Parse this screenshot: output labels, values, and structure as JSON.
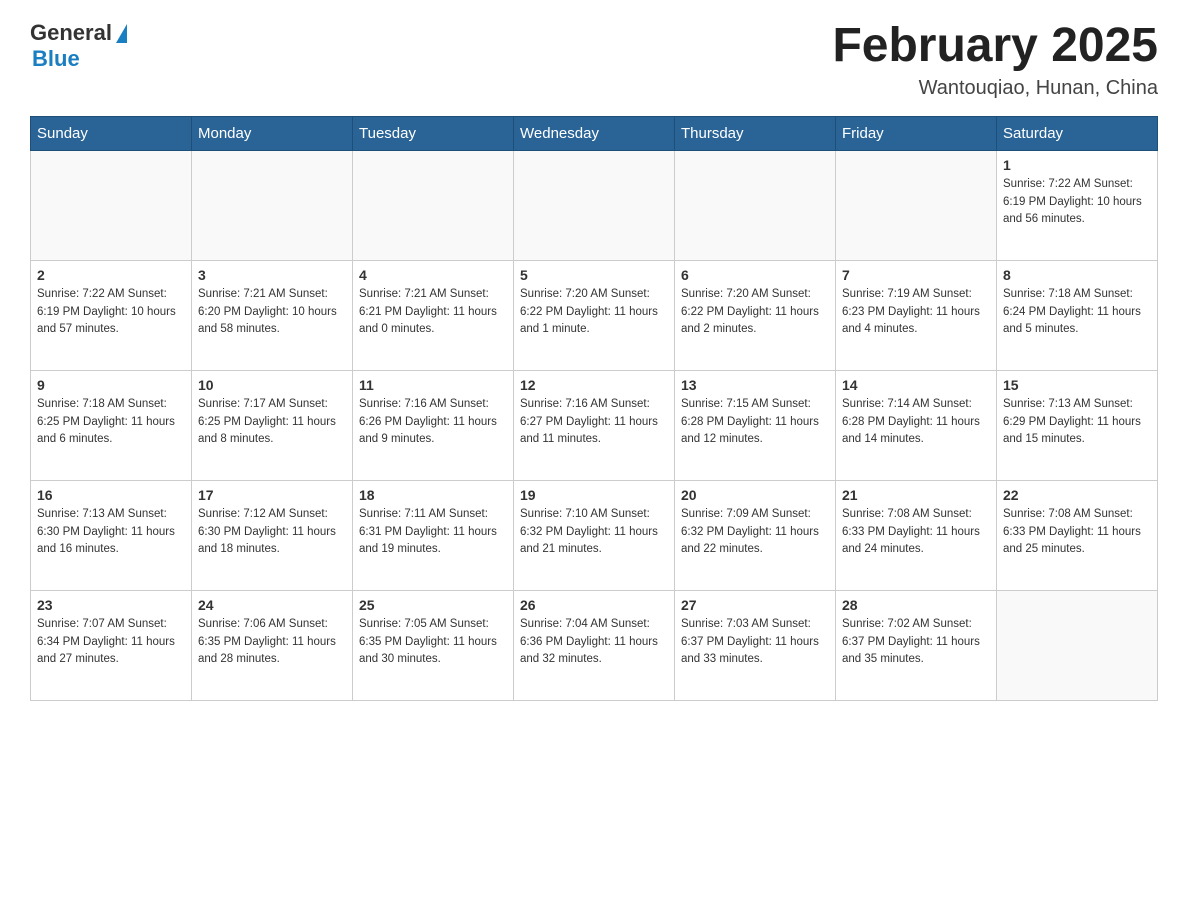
{
  "logo": {
    "general": "General",
    "blue": "Blue"
  },
  "title": "February 2025",
  "subtitle": "Wantouqiao, Hunan, China",
  "days_of_week": [
    "Sunday",
    "Monday",
    "Tuesday",
    "Wednesday",
    "Thursday",
    "Friday",
    "Saturday"
  ],
  "weeks": [
    [
      {
        "day": "",
        "info": ""
      },
      {
        "day": "",
        "info": ""
      },
      {
        "day": "",
        "info": ""
      },
      {
        "day": "",
        "info": ""
      },
      {
        "day": "",
        "info": ""
      },
      {
        "day": "",
        "info": ""
      },
      {
        "day": "1",
        "info": "Sunrise: 7:22 AM\nSunset: 6:19 PM\nDaylight: 10 hours\nand 56 minutes."
      }
    ],
    [
      {
        "day": "2",
        "info": "Sunrise: 7:22 AM\nSunset: 6:19 PM\nDaylight: 10 hours\nand 57 minutes."
      },
      {
        "day": "3",
        "info": "Sunrise: 7:21 AM\nSunset: 6:20 PM\nDaylight: 10 hours\nand 58 minutes."
      },
      {
        "day": "4",
        "info": "Sunrise: 7:21 AM\nSunset: 6:21 PM\nDaylight: 11 hours\nand 0 minutes."
      },
      {
        "day": "5",
        "info": "Sunrise: 7:20 AM\nSunset: 6:22 PM\nDaylight: 11 hours\nand 1 minute."
      },
      {
        "day": "6",
        "info": "Sunrise: 7:20 AM\nSunset: 6:22 PM\nDaylight: 11 hours\nand 2 minutes."
      },
      {
        "day": "7",
        "info": "Sunrise: 7:19 AM\nSunset: 6:23 PM\nDaylight: 11 hours\nand 4 minutes."
      },
      {
        "day": "8",
        "info": "Sunrise: 7:18 AM\nSunset: 6:24 PM\nDaylight: 11 hours\nand 5 minutes."
      }
    ],
    [
      {
        "day": "9",
        "info": "Sunrise: 7:18 AM\nSunset: 6:25 PM\nDaylight: 11 hours\nand 6 minutes."
      },
      {
        "day": "10",
        "info": "Sunrise: 7:17 AM\nSunset: 6:25 PM\nDaylight: 11 hours\nand 8 minutes."
      },
      {
        "day": "11",
        "info": "Sunrise: 7:16 AM\nSunset: 6:26 PM\nDaylight: 11 hours\nand 9 minutes."
      },
      {
        "day": "12",
        "info": "Sunrise: 7:16 AM\nSunset: 6:27 PM\nDaylight: 11 hours\nand 11 minutes."
      },
      {
        "day": "13",
        "info": "Sunrise: 7:15 AM\nSunset: 6:28 PM\nDaylight: 11 hours\nand 12 minutes."
      },
      {
        "day": "14",
        "info": "Sunrise: 7:14 AM\nSunset: 6:28 PM\nDaylight: 11 hours\nand 14 minutes."
      },
      {
        "day": "15",
        "info": "Sunrise: 7:13 AM\nSunset: 6:29 PM\nDaylight: 11 hours\nand 15 minutes."
      }
    ],
    [
      {
        "day": "16",
        "info": "Sunrise: 7:13 AM\nSunset: 6:30 PM\nDaylight: 11 hours\nand 16 minutes."
      },
      {
        "day": "17",
        "info": "Sunrise: 7:12 AM\nSunset: 6:30 PM\nDaylight: 11 hours\nand 18 minutes."
      },
      {
        "day": "18",
        "info": "Sunrise: 7:11 AM\nSunset: 6:31 PM\nDaylight: 11 hours\nand 19 minutes."
      },
      {
        "day": "19",
        "info": "Sunrise: 7:10 AM\nSunset: 6:32 PM\nDaylight: 11 hours\nand 21 minutes."
      },
      {
        "day": "20",
        "info": "Sunrise: 7:09 AM\nSunset: 6:32 PM\nDaylight: 11 hours\nand 22 minutes."
      },
      {
        "day": "21",
        "info": "Sunrise: 7:08 AM\nSunset: 6:33 PM\nDaylight: 11 hours\nand 24 minutes."
      },
      {
        "day": "22",
        "info": "Sunrise: 7:08 AM\nSunset: 6:33 PM\nDaylight: 11 hours\nand 25 minutes."
      }
    ],
    [
      {
        "day": "23",
        "info": "Sunrise: 7:07 AM\nSunset: 6:34 PM\nDaylight: 11 hours\nand 27 minutes."
      },
      {
        "day": "24",
        "info": "Sunrise: 7:06 AM\nSunset: 6:35 PM\nDaylight: 11 hours\nand 28 minutes."
      },
      {
        "day": "25",
        "info": "Sunrise: 7:05 AM\nSunset: 6:35 PM\nDaylight: 11 hours\nand 30 minutes."
      },
      {
        "day": "26",
        "info": "Sunrise: 7:04 AM\nSunset: 6:36 PM\nDaylight: 11 hours\nand 32 minutes."
      },
      {
        "day": "27",
        "info": "Sunrise: 7:03 AM\nSunset: 6:37 PM\nDaylight: 11 hours\nand 33 minutes."
      },
      {
        "day": "28",
        "info": "Sunrise: 7:02 AM\nSunset: 6:37 PM\nDaylight: 11 hours\nand 35 minutes."
      },
      {
        "day": "",
        "info": ""
      }
    ]
  ]
}
